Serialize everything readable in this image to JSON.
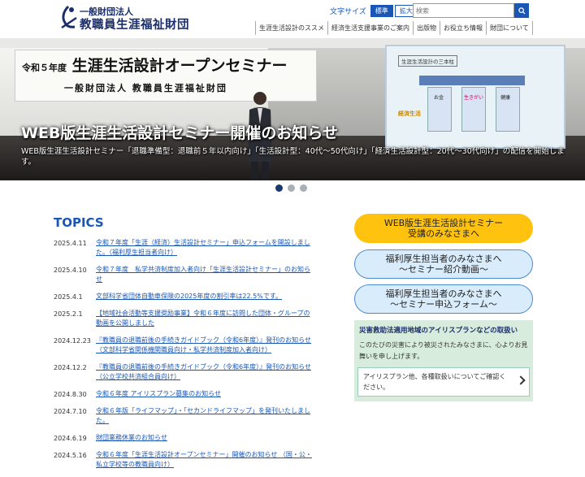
{
  "header": {
    "org_sub": "一般財団法人",
    "org_main": "教職員生涯福祉財団",
    "fontsize_label": "文字サイズ",
    "fontsize_standard": "標準",
    "fontsize_large": "拡大",
    "search_placeholder": "検索",
    "nav": [
      "生涯生活設計のススメ",
      "経済生活支援事業のご案内",
      "出版物",
      "お役立ち情報",
      "財団について"
    ]
  },
  "hero": {
    "banner_line1": "令和５年度",
    "banner_line1b": "生涯生活設計オープンセミナー",
    "banner_line2": "一般財団法人 教職員生涯福祉財団",
    "screen_title": "生涯生活設計の三本柱",
    "screen_label_money": "お金",
    "screen_label_life": "生きがい",
    "screen_label_health": "健康",
    "screen_label_econ": "経済生活",
    "title": "WEB版生涯生活設計セミナー開催のお知らせ",
    "description": "WEB版生涯生活設計セミナー「退職準備型：退職前５年以内向け」「生活設計型：40代～50代向け」「経済生活設計型：20代～30代向け」の配信を開始します。",
    "slides": 3,
    "active_slide": 1
  },
  "topics": {
    "heading": "TOPICS",
    "items": [
      {
        "date": "2025.4.11",
        "text": "令和７年度「生涯（経済）生活設計セミナー」申込フォームを開設しました。（福利厚生担当者向け）"
      },
      {
        "date": "2025.4.10",
        "text": "令和７年度　私学共済制度加入者向け「生涯生活設計セミナー」のお知らせ"
      },
      {
        "date": "2025.4.1",
        "text": "文部科学省団体自動車保険の2025年度の割引率は22.5%です。"
      },
      {
        "date": "2025.2.1",
        "text": "【地域社会活動等支援奨励事業】令和６年度に訪問した団体・グループの動画を公開しました"
      },
      {
        "date": "2024.12.23",
        "text": "『教職員の退職前後の手続きガイドブック（令和6年度）』発刊のお知らせ（文部科学省関係機関職員向け・私学共済制度加入者向け）"
      },
      {
        "date": "2024.12.2",
        "text": "『教職員の退職前後の手続きガイドブック（令和6年度）』発刊のお知らせ（公立学校共済組合員向け）"
      },
      {
        "date": "2024.8.30",
        "text": "令和６年度 アイリスプラン募集のお知らせ"
      },
      {
        "date": "2024.7.10",
        "text": "令和６年版「ライフマップ」・「セカンドライフマップ」を発刊いたしました。"
      },
      {
        "date": "2024.6.19",
        "text": "財団業務休業のお知らせ"
      },
      {
        "date": "2024.5.16",
        "text": "令和６年度「生涯生活設計オープンセミナー」開催のお知らせ （国・公・私立学校等の教職員向け）"
      }
    ]
  },
  "side": {
    "btn1_l1": "WEB版生涯生活設計セミナー",
    "btn1_l2": "受講のみなさまへ",
    "btn2_l1": "福利厚生担当者のみなさまへ",
    "btn2_l2": "～セミナー紹介動画～",
    "btn3_l1": "福利厚生担当者のみなさまへ",
    "btn3_l2": "～セミナー申込フォーム～",
    "disaster_heading": "災害救助法適用地域のアイリスプランなどの取扱い",
    "disaster_body": "このたびの災害により被災されたみなさまに、心よりお見舞いを申し上げます。",
    "disaster_link": "アイリスプラン他、各種取扱いについてご確認ください。"
  },
  "colors": {
    "brand_blue": "#1a57b5",
    "navy": "#1a2e6c",
    "gold": "#ffc20e",
    "light_blue": "#d9ecfb",
    "green_panel": "#d7ecdc"
  }
}
